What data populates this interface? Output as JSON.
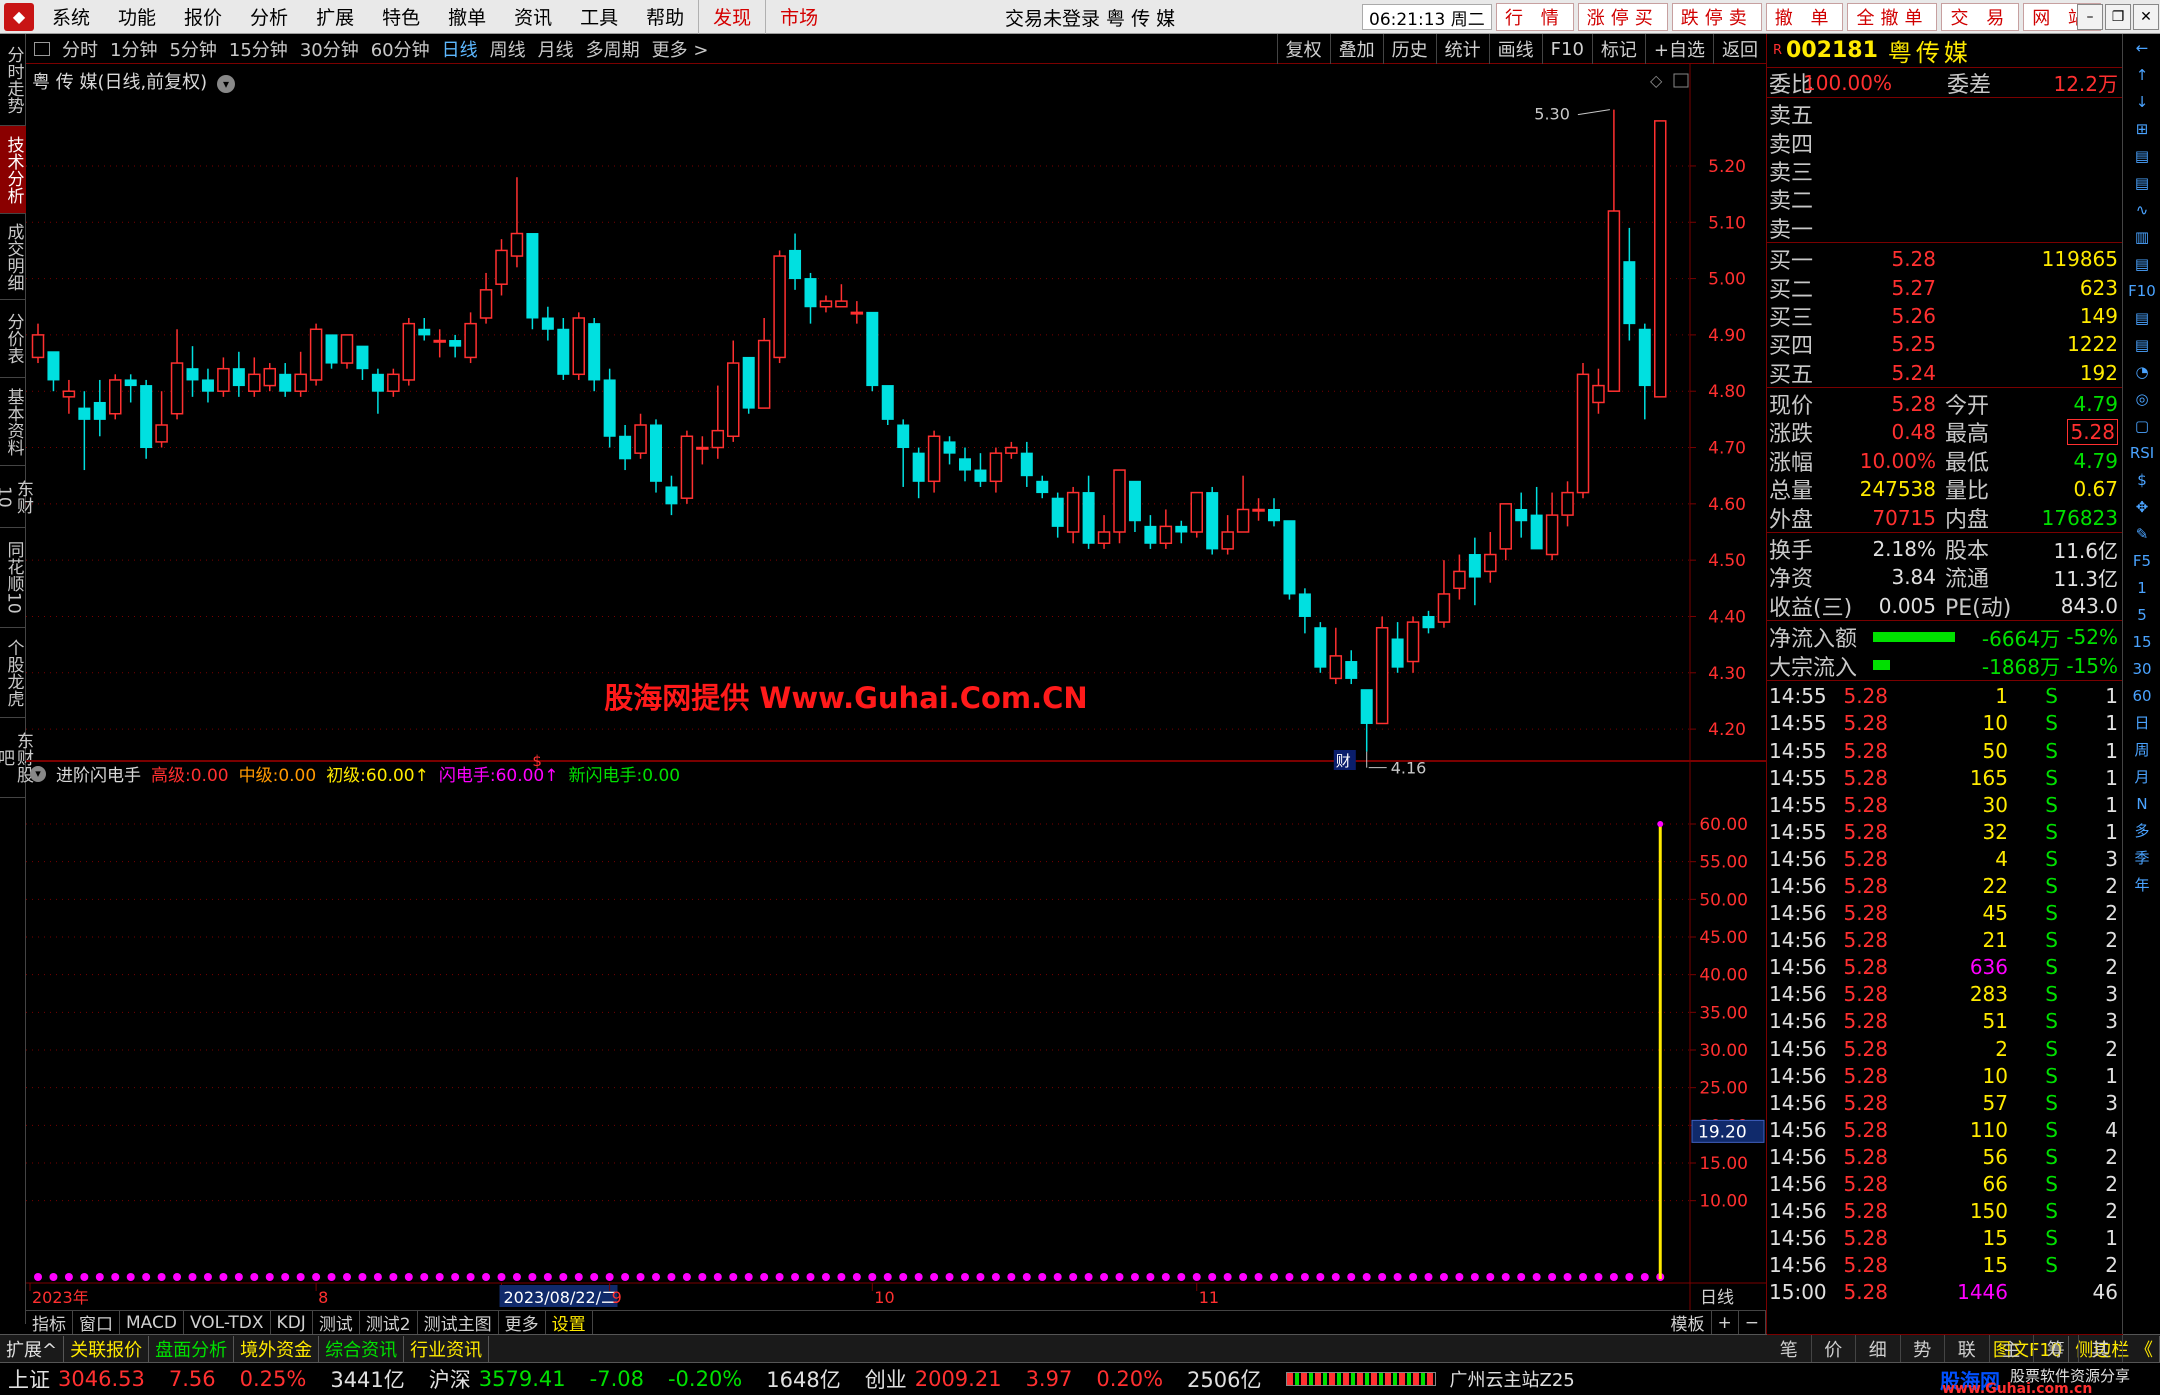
{
  "topbar": {
    "menus": [
      "系统",
      "功能",
      "报价",
      "分析",
      "扩展",
      "特色",
      "撤单",
      "资讯",
      "工具",
      "帮助"
    ],
    "special": [
      "发现",
      "市场"
    ],
    "title": "交易未登录 粤 传 媒",
    "clock": "06:21:13 周二",
    "quick": [
      "行 情",
      "涨停买",
      "跌停卖",
      "撤 单",
      "全撤单",
      "交 易",
      "网 站"
    ]
  },
  "lefttabs": [
    "分时走势",
    "技术分析",
    "成交明细",
    "分价表",
    "基本资料",
    "东财10",
    "同花顺10",
    "个股龙虎",
    "东财股吧"
  ],
  "period": {
    "items": [
      "分时",
      "1分钟",
      "5分钟",
      "15分钟",
      "30分钟",
      "60分钟",
      "日线",
      "周线",
      "月线",
      "多周期",
      "更多 >"
    ],
    "selected": "日线",
    "tools": [
      "复权",
      "叠加",
      "历史",
      "统计",
      "画线",
      "F10",
      "标记",
      "+自选",
      "返回"
    ]
  },
  "price_title": "粤 传 媒(日线,前复权)",
  "watermark": "股海网提供 Www.Guhai.Com.CN",
  "indicator": {
    "name": "进阶闪电手",
    "parts": [
      {
        "label": "高级:",
        "value": "0.00",
        "color": "#ff3030"
      },
      {
        "label": "中级:",
        "value": "0.00",
        "color": "#ff9900"
      },
      {
        "label": "初级:",
        "value": "60.00↑",
        "color": "#ffea00"
      },
      {
        "label": "闪电手:",
        "value": "60.00↑",
        "color": "#ff00ff"
      },
      {
        "label": "新闪电手:",
        "value": "0.00",
        "color": "#00e000"
      }
    ],
    "cursor_value": "19.20"
  },
  "chart_data": {
    "type": "candlestick",
    "title": "粤 传 媒(日线,前复权)",
    "price_axis": [
      5.2,
      5.1,
      5.0,
      4.9,
      4.8,
      4.7,
      4.6,
      4.5,
      4.4,
      4.3,
      4.2
    ],
    "ylim": [
      4.17,
      5.31
    ],
    "indicator_axis": [
      "60.00",
      "55.00",
      "50.00",
      "45.00",
      "40.00",
      "35.00",
      "30.00",
      "25.00",
      "20.00",
      "15.00",
      "10.00"
    ],
    "indicator_ylim": [
      0,
      60
    ],
    "high_label": "5.30",
    "low_label": "4.16",
    "x_labels": [
      "2023年",
      "8",
      "2023/08/22/二",
      "9",
      "10",
      "11",
      "日线"
    ],
    "markers": [
      "$",
      "财"
    ],
    "candles": [
      [
        4.86,
        4.9,
        4.92,
        4.85
      ],
      [
        4.87,
        4.82,
        4.87,
        4.8
      ],
      [
        4.79,
        4.8,
        4.82,
        4.76
      ],
      [
        4.77,
        4.75,
        4.8,
        4.66
      ],
      [
        4.78,
        4.75,
        4.82,
        4.72
      ],
      [
        4.76,
        4.82,
        4.83,
        4.75
      ],
      [
        4.82,
        4.81,
        4.83,
        4.78
      ],
      [
        4.81,
        4.7,
        4.82,
        4.68
      ],
      [
        4.71,
        4.74,
        4.8,
        4.7
      ],
      [
        4.76,
        4.85,
        4.91,
        4.75
      ],
      [
        4.84,
        4.82,
        4.88,
        4.79
      ],
      [
        4.82,
        4.8,
        4.84,
        4.78
      ],
      [
        4.8,
        4.84,
        4.86,
        4.79
      ],
      [
        4.84,
        4.81,
        4.87,
        4.79
      ],
      [
        4.8,
        4.83,
        4.86,
        4.79
      ],
      [
        4.81,
        4.84,
        4.85,
        4.8
      ],
      [
        4.83,
        4.8,
        4.85,
        4.79
      ],
      [
        4.8,
        4.83,
        4.87,
        4.79
      ],
      [
        4.82,
        4.91,
        4.92,
        4.81
      ],
      [
        4.9,
        4.85,
        4.9,
        4.84
      ],
      [
        4.85,
        4.9,
        4.9,
        4.84
      ],
      [
        4.88,
        4.84,
        4.88,
        4.82
      ],
      [
        4.83,
        4.8,
        4.84,
        4.76
      ],
      [
        4.8,
        4.83,
        4.84,
        4.79
      ],
      [
        4.82,
        4.92,
        4.93,
        4.81
      ],
      [
        4.91,
        4.9,
        4.93,
        4.89
      ],
      [
        4.89,
        4.89,
        4.91,
        4.86
      ],
      [
        4.89,
        4.88,
        4.9,
        4.86
      ],
      [
        4.86,
        4.92,
        4.94,
        4.85
      ],
      [
        4.93,
        4.98,
        5.01,
        4.92
      ],
      [
        4.99,
        5.05,
        5.07,
        4.97
      ],
      [
        5.04,
        5.08,
        5.18,
        5.02
      ],
      [
        5.08,
        4.93,
        5.08,
        4.91
      ],
      [
        4.93,
        4.91,
        4.95,
        4.89
      ],
      [
        4.91,
        4.83,
        4.93,
        4.82
      ],
      [
        4.83,
        4.93,
        4.94,
        4.82
      ],
      [
        4.92,
        4.82,
        4.93,
        4.8
      ],
      [
        4.82,
        4.72,
        4.84,
        4.7
      ],
      [
        4.72,
        4.68,
        4.74,
        4.66
      ],
      [
        4.69,
        4.74,
        4.76,
        4.68
      ],
      [
        4.74,
        4.64,
        4.75,
        4.62
      ],
      [
        4.63,
        4.6,
        4.65,
        4.58
      ],
      [
        4.61,
        4.72,
        4.73,
        4.6
      ],
      [
        4.7,
        4.7,
        4.72,
        4.67
      ],
      [
        4.7,
        4.73,
        4.81,
        4.68
      ],
      [
        4.72,
        4.85,
        4.89,
        4.71
      ],
      [
        4.86,
        4.77,
        4.86,
        4.76
      ],
      [
        4.77,
        4.89,
        4.93,
        4.77
      ],
      [
        4.86,
        5.04,
        5.05,
        4.85
      ],
      [
        5.05,
        5.0,
        5.08,
        4.98
      ],
      [
        5.0,
        4.95,
        5.01,
        4.92
      ],
      [
        4.95,
        4.96,
        4.97,
        4.94
      ],
      [
        4.95,
        4.96,
        4.99,
        4.95
      ],
      [
        4.94,
        4.94,
        4.96,
        4.92
      ],
      [
        4.94,
        4.81,
        4.94,
        4.8
      ],
      [
        4.81,
        4.75,
        4.81,
        4.74
      ],
      [
        4.74,
        4.7,
        4.75,
        4.63
      ],
      [
        4.69,
        4.64,
        4.7,
        4.61
      ],
      [
        4.64,
        4.72,
        4.73,
        4.62
      ],
      [
        4.71,
        4.69,
        4.72,
        4.67
      ],
      [
        4.68,
        4.66,
        4.7,
        4.64
      ],
      [
        4.66,
        4.64,
        4.69,
        4.63
      ],
      [
        4.64,
        4.69,
        4.7,
        4.62
      ],
      [
        4.69,
        4.7,
        4.71,
        4.68
      ],
      [
        4.69,
        4.65,
        4.71,
        4.63
      ],
      [
        4.64,
        4.62,
        4.65,
        4.61
      ],
      [
        4.61,
        4.56,
        4.62,
        4.54
      ],
      [
        4.55,
        4.62,
        4.63,
        4.53
      ],
      [
        4.62,
        4.53,
        4.65,
        4.52
      ],
      [
        4.53,
        4.55,
        4.58,
        4.52
      ],
      [
        4.55,
        4.66,
        4.66,
        4.53
      ],
      [
        4.64,
        4.57,
        4.64,
        4.55
      ],
      [
        4.56,
        4.53,
        4.58,
        4.52
      ],
      [
        4.53,
        4.56,
        4.59,
        4.52
      ],
      [
        4.56,
        4.55,
        4.57,
        4.53
      ],
      [
        4.55,
        4.62,
        4.62,
        4.54
      ],
      [
        4.62,
        4.52,
        4.63,
        4.51
      ],
      [
        4.52,
        4.55,
        4.58,
        4.51
      ],
      [
        4.55,
        4.59,
        4.65,
        4.55
      ],
      [
        4.59,
        4.59,
        4.61,
        4.57
      ],
      [
        4.59,
        4.57,
        4.61,
        4.56
      ],
      [
        4.57,
        4.44,
        4.57,
        4.43
      ],
      [
        4.44,
        4.4,
        4.45,
        4.37
      ],
      [
        4.38,
        4.31,
        4.39,
        4.3
      ],
      [
        4.29,
        4.33,
        4.38,
        4.28
      ],
      [
        4.32,
        4.29,
        4.34,
        4.28
      ],
      [
        4.27,
        4.21,
        4.27,
        4.16
      ],
      [
        4.21,
        4.38,
        4.4,
        4.21
      ],
      [
        4.36,
        4.31,
        4.39,
        4.3
      ],
      [
        4.32,
        4.39,
        4.4,
        4.3
      ],
      [
        4.4,
        4.38,
        4.41,
        4.37
      ],
      [
        4.39,
        4.44,
        4.5,
        4.38
      ],
      [
        4.45,
        4.48,
        4.51,
        4.43
      ],
      [
        4.51,
        4.47,
        4.54,
        4.42
      ],
      [
        4.48,
        4.51,
        4.55,
        4.46
      ],
      [
        4.52,
        4.6,
        4.6,
        4.5
      ],
      [
        4.59,
        4.57,
        4.62,
        4.54
      ],
      [
        4.58,
        4.52,
        4.63,
        4.52
      ],
      [
        4.51,
        4.58,
        4.62,
        4.5
      ],
      [
        4.58,
        4.62,
        4.64,
        4.56
      ],
      [
        4.62,
        4.83,
        4.85,
        4.61
      ],
      [
        4.78,
        4.81,
        4.84,
        4.76
      ],
      [
        4.8,
        5.12,
        5.3,
        4.8
      ],
      [
        5.03,
        4.92,
        5.09,
        4.89
      ],
      [
        4.91,
        4.81,
        4.92,
        4.75
      ],
      [
        4.79,
        5.28,
        5.28,
        4.79
      ]
    ],
    "indicator_series": [
      {
        "name": "初级",
        "values_last": 60
      }
    ]
  },
  "quote": {
    "code": "002181",
    "name": "粤传媒",
    "weibi_label": "委比",
    "weibi": "100.00%",
    "weicha_label": "委差",
    "weicha": "12.2万",
    "sells": [
      {
        "label": "卖五",
        "price": "",
        "vol": ""
      },
      {
        "label": "卖四",
        "price": "",
        "vol": ""
      },
      {
        "label": "卖三",
        "price": "",
        "vol": ""
      },
      {
        "label": "卖二",
        "price": "",
        "vol": ""
      },
      {
        "label": "卖一",
        "price": "",
        "vol": ""
      }
    ],
    "buys": [
      {
        "label": "买一",
        "price": "5.28",
        "vol": "119865"
      },
      {
        "label": "买二",
        "price": "5.27",
        "vol": "623"
      },
      {
        "label": "买三",
        "price": "5.26",
        "vol": "149"
      },
      {
        "label": "买四",
        "price": "5.25",
        "vol": "1222"
      },
      {
        "label": "买五",
        "price": "5.24",
        "vol": "192"
      }
    ],
    "stats": [
      {
        "l1": "现价",
        "v1": "5.28",
        "c1": "up",
        "l2": "今开",
        "v2": "4.79",
        "c2": "down"
      },
      {
        "l1": "涨跌",
        "v1": "0.48",
        "c1": "up",
        "l2": "最高",
        "v2": "5.28",
        "c2": "up"
      },
      {
        "l1": "涨幅",
        "v1": "10.00%",
        "c1": "up",
        "l2": "最低",
        "v2": "4.79",
        "c2": "down"
      },
      {
        "l1": "总量",
        "v1": "247538",
        "c1": "yel",
        "l2": "量比",
        "v2": "0.67",
        "c2": "yel"
      },
      {
        "l1": "外盘",
        "v1": "70715",
        "c1": "up",
        "l2": "内盘",
        "v2": "176823",
        "c2": "down"
      }
    ],
    "stats2": [
      {
        "l1": "换手",
        "v1": "2.18%",
        "l2": "股本",
        "v2": "11.6亿"
      },
      {
        "l1": "净资",
        "v1": "3.84",
        "l2": "流通",
        "v2": "11.3亿"
      },
      {
        "l1": "收益(三)",
        "v1": "0.005",
        "l2": "PE(动)",
        "v2": "843.0"
      }
    ],
    "flows": [
      {
        "label": "净流入额",
        "bar": 0.85,
        "value": "-6664万",
        "pct": "-52%"
      },
      {
        "label": "大宗流入",
        "bar": 0.18,
        "value": "-1868万",
        "pct": "-15%"
      }
    ],
    "ticks": [
      [
        "14:55",
        "5.28",
        "1",
        "S",
        "1"
      ],
      [
        "14:55",
        "5.28",
        "10",
        "S",
        "1"
      ],
      [
        "14:55",
        "5.28",
        "50",
        "S",
        "1"
      ],
      [
        "14:55",
        "5.28",
        "165",
        "S",
        "1"
      ],
      [
        "14:55",
        "5.28",
        "30",
        "S",
        "1"
      ],
      [
        "14:55",
        "5.28",
        "32",
        "S",
        "1"
      ],
      [
        "14:56",
        "5.28",
        "4",
        "S",
        "3"
      ],
      [
        "14:56",
        "5.28",
        "22",
        "S",
        "2"
      ],
      [
        "14:56",
        "5.28",
        "45",
        "S",
        "2"
      ],
      [
        "14:56",
        "5.28",
        "21",
        "S",
        "2"
      ],
      [
        "14:56",
        "5.28",
        "636",
        "S",
        "2"
      ],
      [
        "14:56",
        "5.28",
        "283",
        "S",
        "3"
      ],
      [
        "14:56",
        "5.28",
        "51",
        "S",
        "3"
      ],
      [
        "14:56",
        "5.28",
        "2",
        "S",
        "2"
      ],
      [
        "14:56",
        "5.28",
        "10",
        "S",
        "1"
      ],
      [
        "14:56",
        "5.28",
        "57",
        "S",
        "3"
      ],
      [
        "14:56",
        "5.28",
        "110",
        "S",
        "4"
      ],
      [
        "14:56",
        "5.28",
        "56",
        "S",
        "2"
      ],
      [
        "14:56",
        "5.28",
        "66",
        "S",
        "2"
      ],
      [
        "14:56",
        "5.28",
        "150",
        "S",
        "2"
      ],
      [
        "14:56",
        "5.28",
        "15",
        "S",
        "1"
      ],
      [
        "14:56",
        "5.28",
        "15",
        "S",
        "2"
      ],
      [
        "15:00",
        "5.28",
        "1446",
        "",
        "46"
      ]
    ],
    "tabs": [
      "笔",
      "价",
      "细",
      "势",
      "联",
      "主",
      "筹",
      "其"
    ]
  },
  "bottom_tabs": [
    "指标",
    "窗口",
    "MACD",
    "VOL-TDX",
    "KDJ",
    "测试",
    "测试2",
    "测试主图",
    "更多",
    "设置"
  ],
  "bottom_right": [
    "模板",
    "+",
    "−"
  ],
  "ext_tabs": [
    "扩展^",
    "关联报价",
    "盘面分析",
    "境外资金",
    "综合资讯",
    "行业资讯"
  ],
  "ext_right": [
    "图文F10",
    "侧边栏 《"
  ],
  "status": {
    "sh_label": "上证",
    "sh_val": "3046.53",
    "sh_chg": "7.56",
    "sh_pct": "0.25%",
    "sh_amt": "3441亿",
    "sz_label": "沪深",
    "sz_val": "3579.41",
    "sz_chg": "-7.08",
    "sz_pct": "-0.20%",
    "sz_amt": "1648亿",
    "cy_label": "创业",
    "cy_val": "2009.21",
    "cy_chg": "3.97",
    "cy_pct": "0.20%",
    "cy_amt": "2506亿",
    "server": "广州云主站Z25",
    "brand": "股海网",
    "brand2": "股票软件资源分享",
    "brand_url": "www.Guhai.com.cn"
  },
  "side_icons": [
    "←",
    "↑",
    "↓",
    "⊞",
    "▤",
    "▤",
    "∿",
    "▥",
    "▤",
    "F10",
    "▤",
    "▤",
    "◔",
    "◎",
    "▢",
    "RSI",
    "$",
    "✥",
    "✎",
    "F5",
    "1",
    "5",
    "15",
    "30",
    "60",
    "日",
    "周",
    "月",
    "N",
    "多",
    "季",
    "年"
  ],
  "colors": {
    "up": "#ff3030",
    "down": "#00e0e0",
    "grid": "#7a0000",
    "indicator": "#ffea00",
    "dots": "#ff00ff"
  }
}
